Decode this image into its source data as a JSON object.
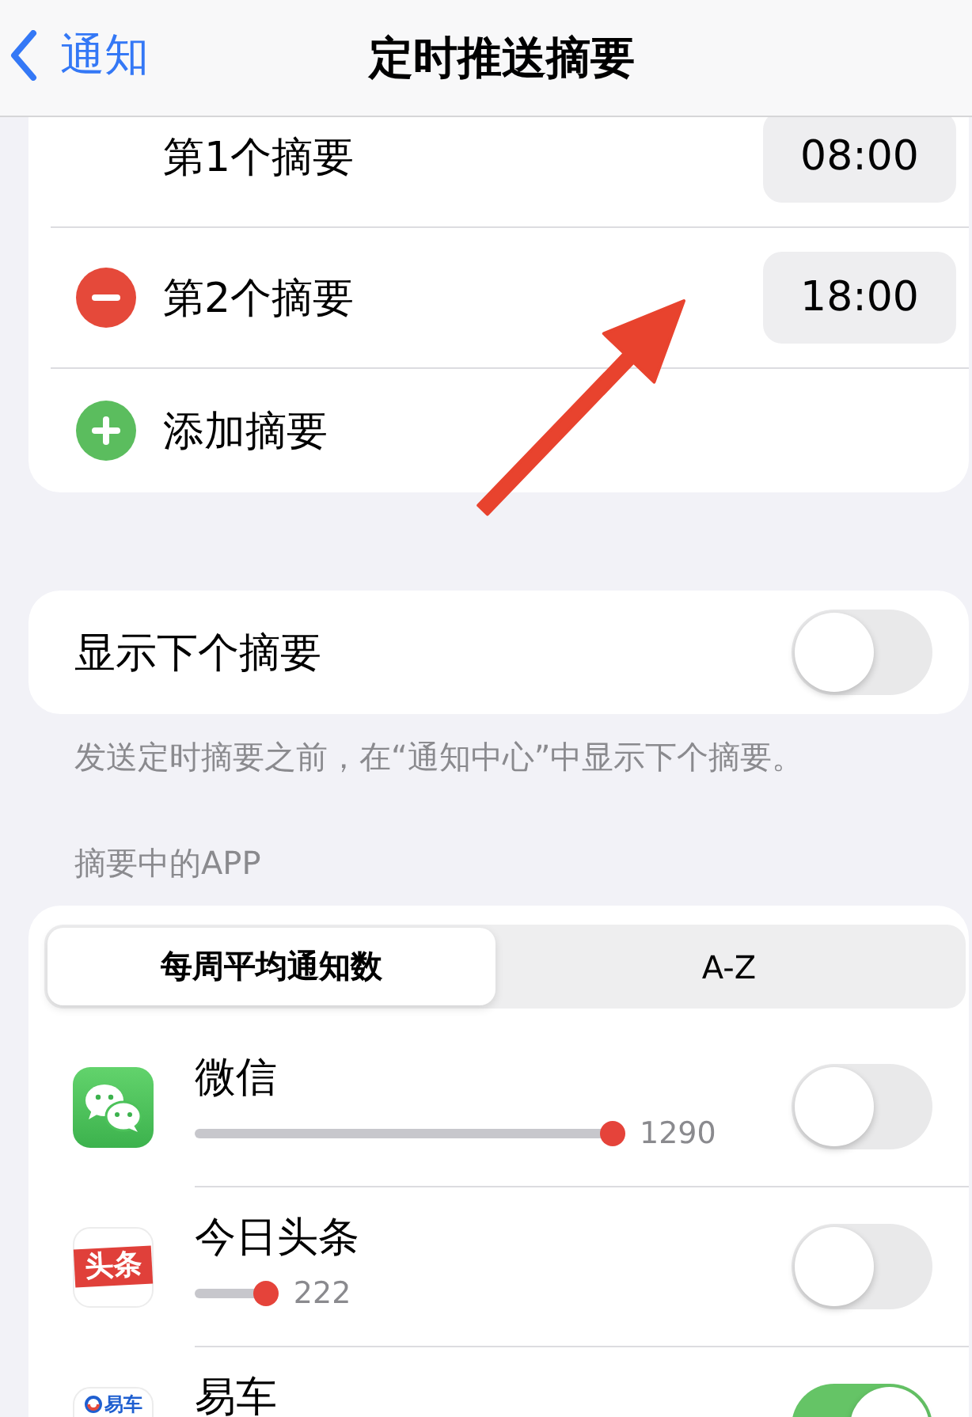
{
  "nav": {
    "back_label": "通知",
    "title": "定时推送摘要"
  },
  "schedule": {
    "rows": [
      {
        "kind": "time",
        "label": "第1个摘要",
        "time": "08:00",
        "removable": false
      },
      {
        "kind": "time",
        "label": "第2个摘要",
        "time": "18:00",
        "removable": true
      },
      {
        "kind": "add",
        "label": "添加摘要"
      }
    ]
  },
  "show_next": {
    "label": "显示下个摘要",
    "on": false,
    "footer": "发送定时摘要之前，在“通知中心”中显示下个摘要。"
  },
  "apps_section": {
    "header": "摘要中的APP",
    "sort_tabs": [
      {
        "label": "每周平均通知数",
        "selected": true
      },
      {
        "label": "A-Z",
        "selected": false
      }
    ],
    "apps": [
      {
        "name": "微信",
        "kind": "bubbles",
        "count": "1290",
        "on": false
      },
      {
        "name": "今日头条",
        "kind": "banner",
        "logo_text": "头条",
        "count": "222",
        "on": false
      },
      {
        "name": "易车",
        "kind": "wordmark",
        "logo_text": "易车",
        "on": true
      }
    ]
  },
  "annotation": {
    "kind": "arrow"
  }
}
